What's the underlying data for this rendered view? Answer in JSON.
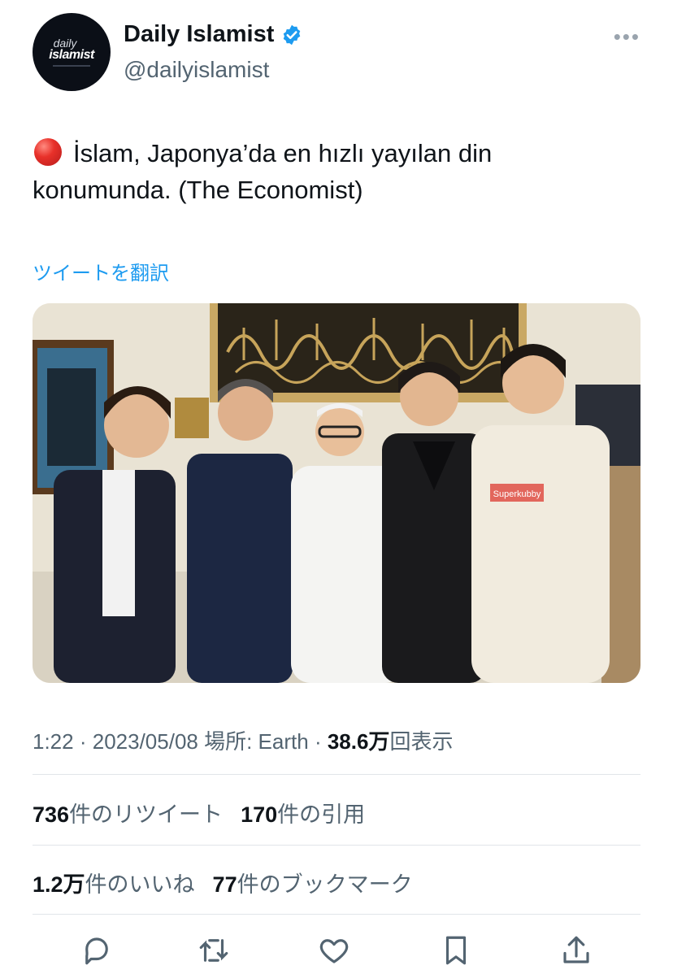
{
  "account": {
    "avatar_line1": "daily",
    "avatar_line2": "islamist",
    "name": "Daily Islamist",
    "handle": "@dailyislamist",
    "verified_icon": "verified-badge-icon",
    "more_label": "•••"
  },
  "tweet": {
    "emoji": "red-circle-icon",
    "text": "İslam, Japonya’da en hızlı yayılan din konumunda. (The Economist)",
    "translate_label": "ツイートを翻訳"
  },
  "photo": {
    "hoodie_text": "Superkubby"
  },
  "meta": {
    "time": "1:22",
    "date": "2023/05/08",
    "location_label": "場所: Earth",
    "views_value": "38.6万",
    "views_label": "回表示"
  },
  "stats": {
    "retweets_value": "736",
    "retweets_label": "件のリツイート",
    "quotes_value": "170",
    "quotes_label": "件の引用",
    "likes_value": "1.2万",
    "likes_label": "件のいいね",
    "bookmarks_value": "77",
    "bookmarks_label": "件のブックマーク"
  },
  "actions": [
    "reply-icon",
    "retweet-icon",
    "like-icon",
    "bookmark-icon",
    "share-icon"
  ],
  "colors": {
    "accent": "#1d9bf0",
    "secondary_text": "#536471",
    "primary_text": "#0f1419"
  }
}
